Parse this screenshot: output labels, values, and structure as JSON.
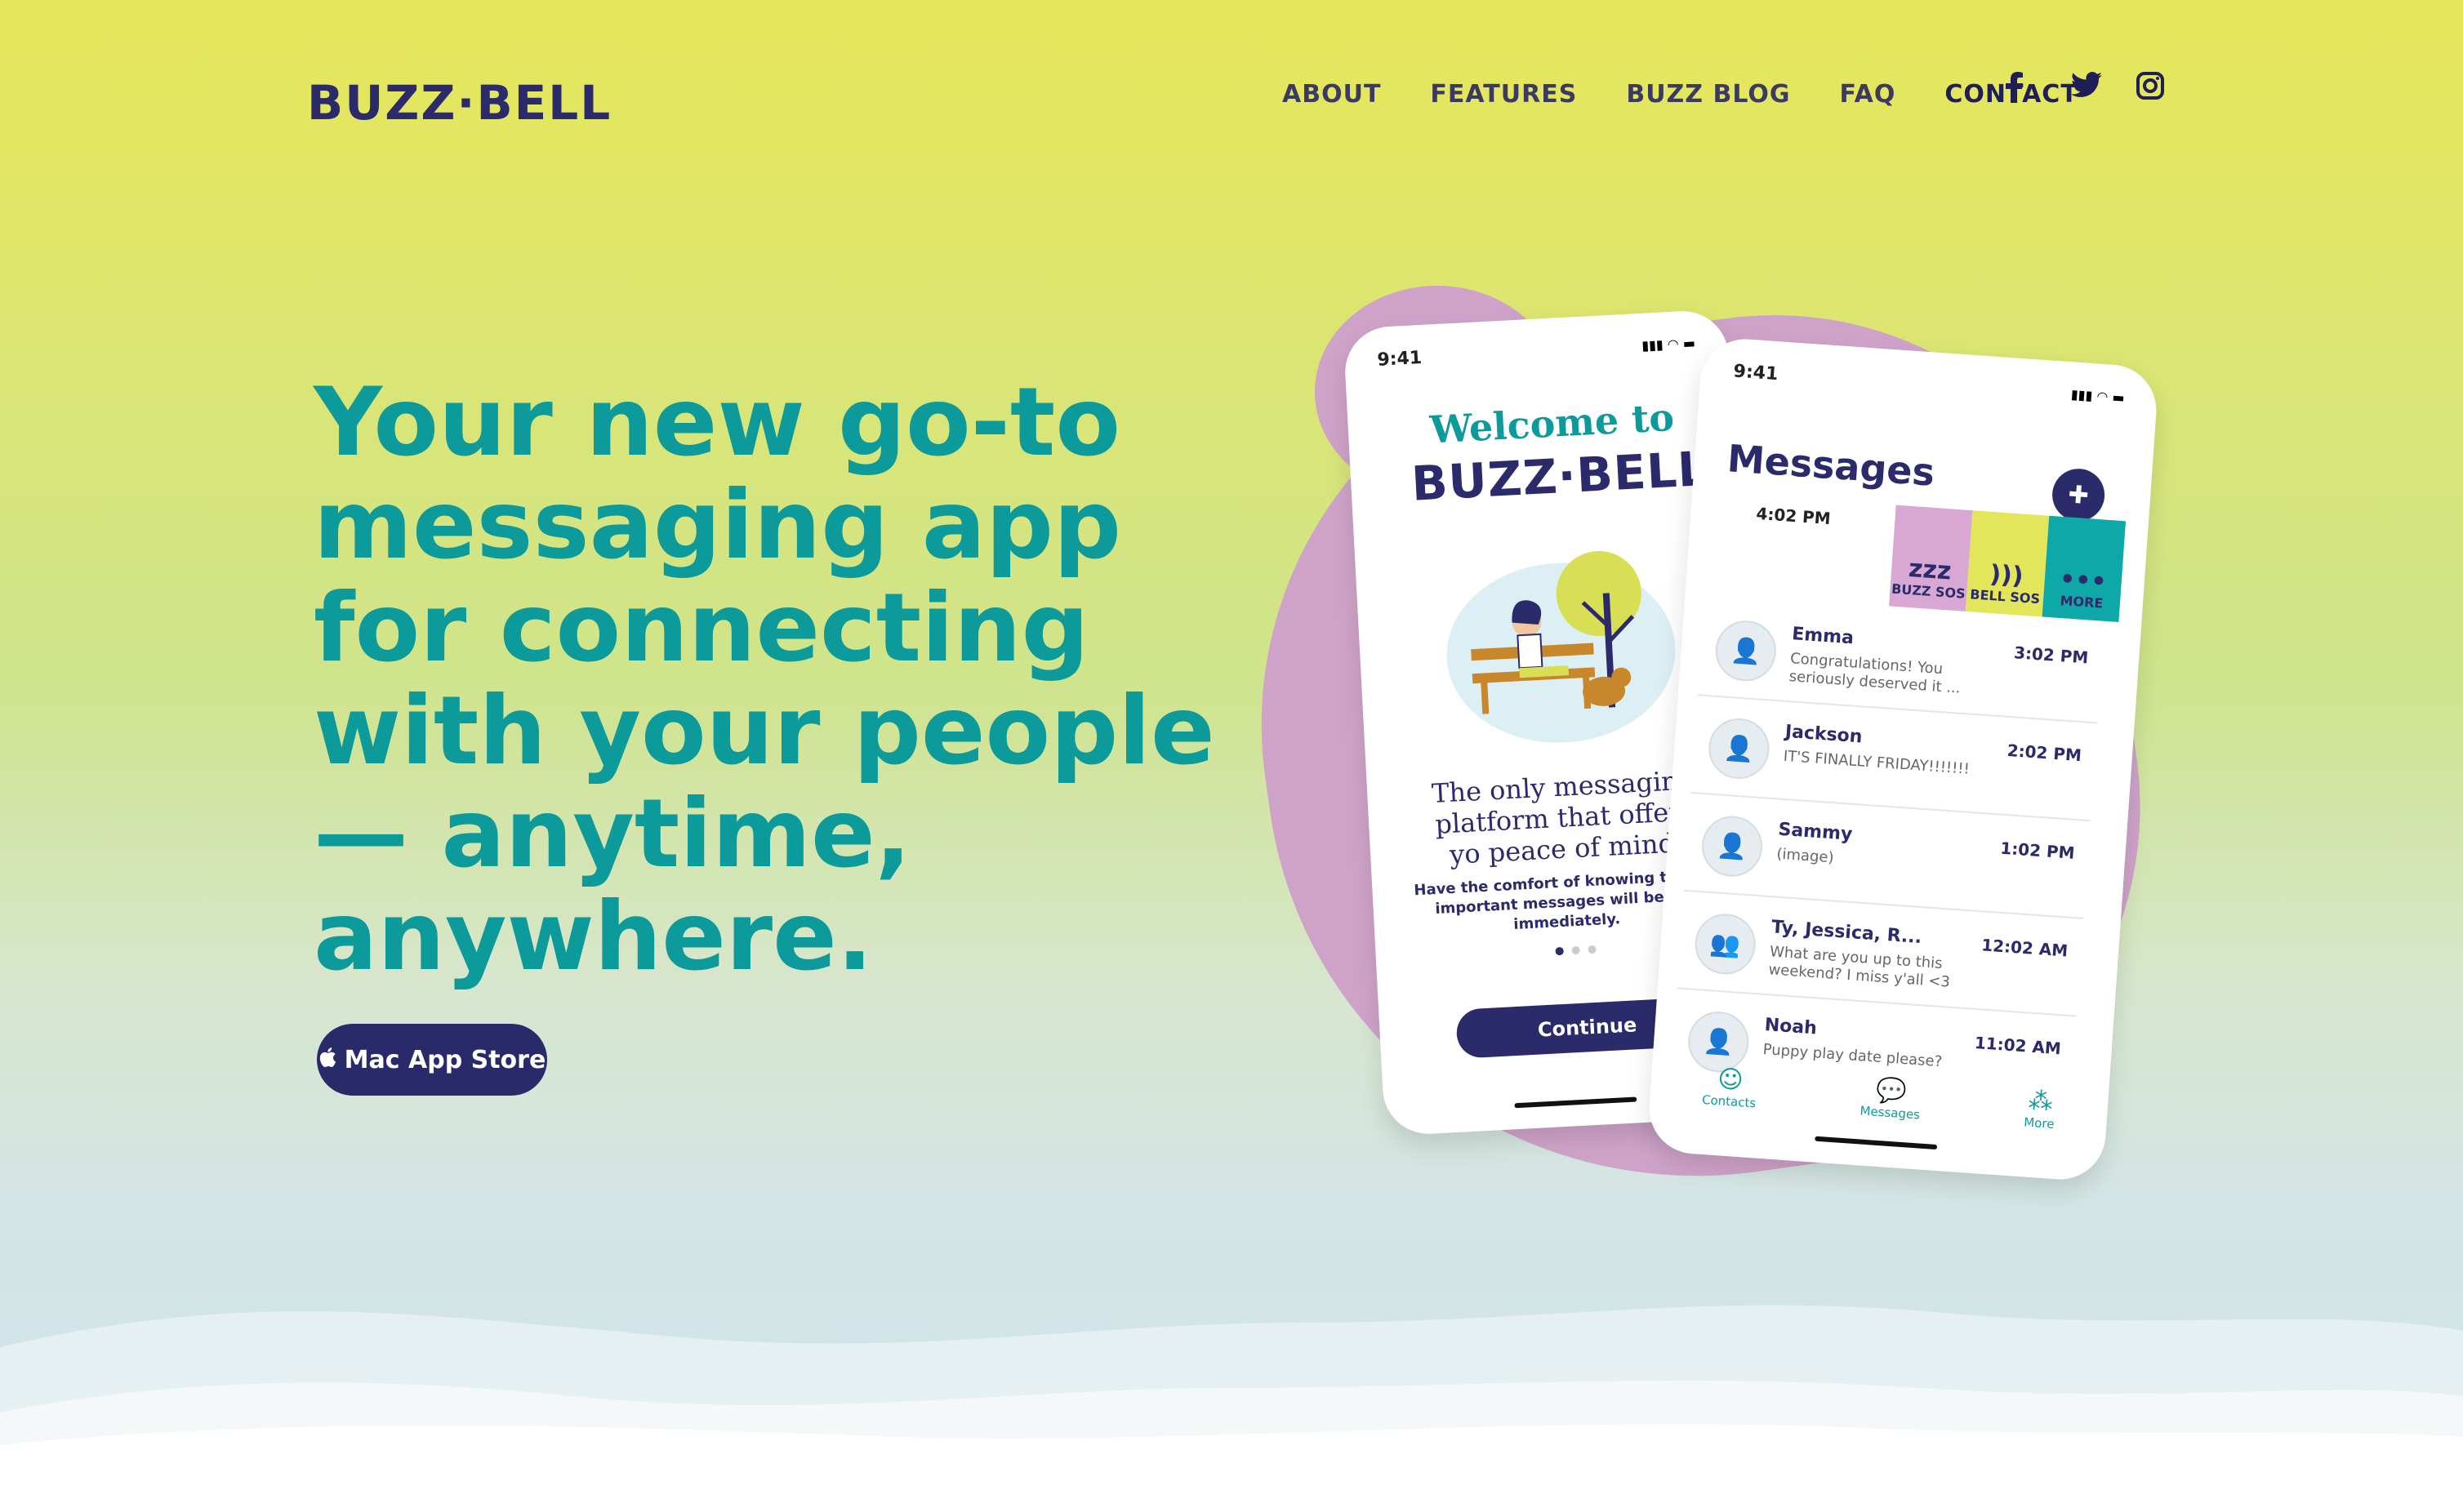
{
  "brand": {
    "logo": "BUZZ·BELL"
  },
  "nav": {
    "items": [
      {
        "label": "ABOUT"
      },
      {
        "label": "FEATURES"
      },
      {
        "label": "BUZZ BLOG"
      },
      {
        "label": "FAQ"
      },
      {
        "label": "CONTACT"
      }
    ],
    "social": [
      {
        "icon": "facebook-icon",
        "glyph": "f"
      },
      {
        "icon": "twitter-icon",
        "glyph": "🐦"
      },
      {
        "icon": "instagram-icon",
        "glyph": "◎"
      }
    ]
  },
  "hero": {
    "headline_lines": [
      "Your new go-to",
      "messaging app",
      "for connecting",
      "with your people",
      "— anytime,",
      "anywhere."
    ],
    "store_button": "Mac App Store"
  },
  "phone_welcome": {
    "time": "9:41",
    "title": "Welcome to",
    "logo": "BUZZ·BELL",
    "tagline": "The only messaging platform that offers yo peace of mind.",
    "subtext": "Have the comfort of knowing that lif important messages will be not immediately.",
    "continue": "Continue"
  },
  "phone_messages": {
    "time": "9:41",
    "title": "Messages",
    "row_time": "4:02 PM",
    "sos": [
      {
        "icon": "zzz",
        "label": "BUZZ SOS",
        "color": "#d9a7d3"
      },
      {
        "icon": ")))",
        "label": "BELL SOS",
        "color": "#e3e55a"
      },
      {
        "icon": "•••",
        "label": "MORE",
        "color": "#0fa8a8"
      }
    ],
    "conversations": [
      {
        "name": "Emma",
        "message": "Congratulations! You seriously deserved it ...",
        "time": "3:02 PM"
      },
      {
        "name": "Jackson",
        "message": "IT'S FINALLY FRIDAY!!!!!!!",
        "time": "2:02 PM"
      },
      {
        "name": "Sammy",
        "message": "(image)",
        "time": "1:02 PM"
      },
      {
        "name": "Ty, Jessica, R...",
        "message": "What are you up to this weekend? I miss y'all <3",
        "time": "12:02 AM"
      },
      {
        "name": "Noah",
        "message": "Puppy play date please?",
        "time": "11:02 AM"
      }
    ],
    "tabs": [
      {
        "label": "Contacts",
        "icon": "contacts-icon"
      },
      {
        "label": "Messages",
        "icon": "messages-icon"
      },
      {
        "label": "More",
        "icon": "more-icon"
      }
    ]
  },
  "colors": {
    "teal": "#0c9a9a",
    "navy": "#2b2a6b",
    "pink_blob": "#cfa3c9",
    "yellow": "#e6e55a"
  }
}
